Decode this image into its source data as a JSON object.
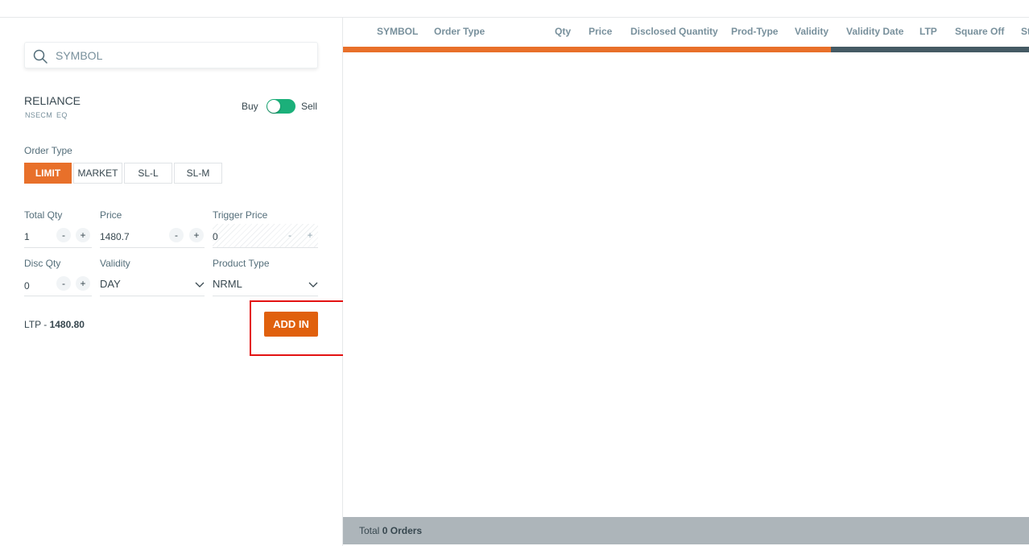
{
  "search": {
    "placeholder": "SYMBOL"
  },
  "instrument": {
    "name": "RELIANCE",
    "exchange": "NSECM",
    "series": "EQ"
  },
  "side_toggle": {
    "buy_label": "Buy",
    "sell_label": "Sell",
    "selected": "Sell"
  },
  "order_type": {
    "label": "Order Type",
    "options": [
      "LIMIT",
      "MARKET",
      "SL-L",
      "SL-M"
    ],
    "selected": "LIMIT"
  },
  "fields": {
    "total_qty": {
      "label": "Total Qty",
      "value": "1"
    },
    "price": {
      "label": "Price",
      "value": "1480.7"
    },
    "trigger_price": {
      "label": "Trigger Price",
      "value": "0"
    },
    "disc_qty": {
      "label": "Disc Qty",
      "value": "0"
    },
    "validity": {
      "label": "Validity",
      "value": "DAY"
    },
    "product_type": {
      "label": "Product Type",
      "value": "NRML"
    }
  },
  "stepper": {
    "minus": "-",
    "plus": "+"
  },
  "ltp": {
    "label": "LTP - ",
    "value": "1480.80"
  },
  "add_button": {
    "label": "ADD IN"
  },
  "table": {
    "columns": [
      "SYMBOL",
      "Order Type",
      "Qty",
      "Price",
      "Disclosed Quantity",
      "Prod-Type",
      "Validity",
      "Validity Date",
      "LTP",
      "Square Off",
      "St"
    ]
  },
  "footer": {
    "prefix": "Total",
    "count": "0",
    "suffix": "Orders"
  },
  "colors": {
    "accent": "#e8702a",
    "button": "#e0600d",
    "toggle": "#1bb07a",
    "bar_dark": "#455a64",
    "highlight": "#e31212"
  },
  "icons": {
    "search": "search-icon",
    "chevron": "chevron-down-icon"
  }
}
